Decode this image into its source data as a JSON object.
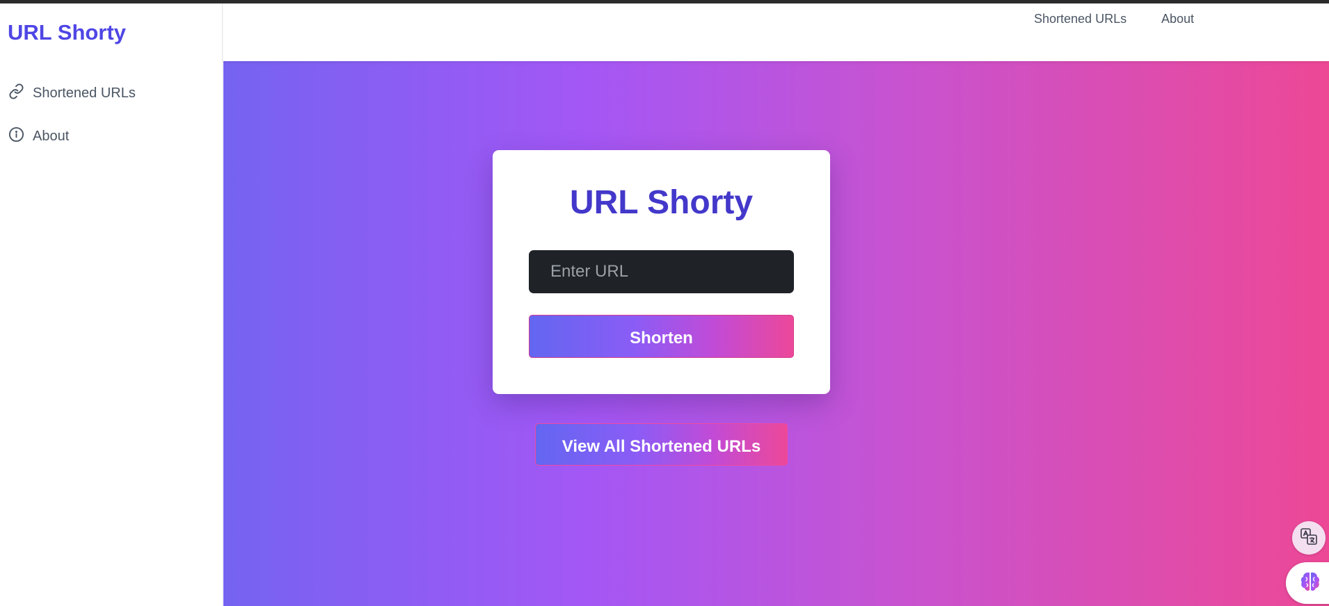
{
  "app": {
    "brand": "URL Shorty"
  },
  "sidebar": {
    "items": [
      {
        "label": "Shortened URLs",
        "icon": "link-icon"
      },
      {
        "label": "About",
        "icon": "info-icon"
      }
    ]
  },
  "topnav": {
    "links": [
      {
        "label": "Shortened URLs"
      },
      {
        "label": "About"
      }
    ]
  },
  "main": {
    "card_title": "URL Shorty",
    "url_input": {
      "placeholder": "Enter URL",
      "value": ""
    },
    "shorten_label": "Shorten",
    "view_all_label": "View All Shortened URLs"
  },
  "widgets": {
    "translate_icon": "translate-icon",
    "assistant_icon": "brain-icon"
  },
  "colors": {
    "brand": "#4f46e5",
    "title": "#4338ca",
    "gradient_start": "#6366f1",
    "gradient_mid": "#a855f7",
    "gradient_end": "#ec4899",
    "input_bg": "#1f2328"
  }
}
